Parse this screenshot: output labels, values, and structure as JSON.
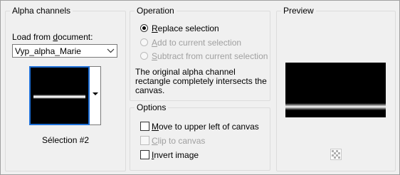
{
  "alpha_channels": {
    "title": "Alpha channels",
    "load_from_label": "Load from document:",
    "document_select_value": "Vyp_alpha_Marie",
    "selection_label": "Sélection #2"
  },
  "operation": {
    "title": "Operation",
    "options": [
      {
        "label": "Replace selection",
        "selected": true,
        "enabled": true
      },
      {
        "label": "Add to current selection",
        "selected": false,
        "enabled": false
      },
      {
        "label": "Subtract from current selection",
        "selected": false,
        "enabled": false
      }
    ],
    "description": [
      "The original alpha channel",
      "rectangle completely intersects the",
      "canvas."
    ]
  },
  "options": {
    "title": "Options",
    "items": [
      {
        "label": "Move to upper left of canvas",
        "checked": false,
        "enabled": true
      },
      {
        "label": "Clip to canvas",
        "checked": false,
        "enabled": false
      },
      {
        "label": "Invert image",
        "checked": false,
        "enabled": true
      }
    ]
  },
  "preview": {
    "title": "Preview"
  },
  "colors": {
    "accent": "#1e6fd6",
    "disabled_text": "#a0a0a0",
    "background": "#f0f0f0"
  }
}
